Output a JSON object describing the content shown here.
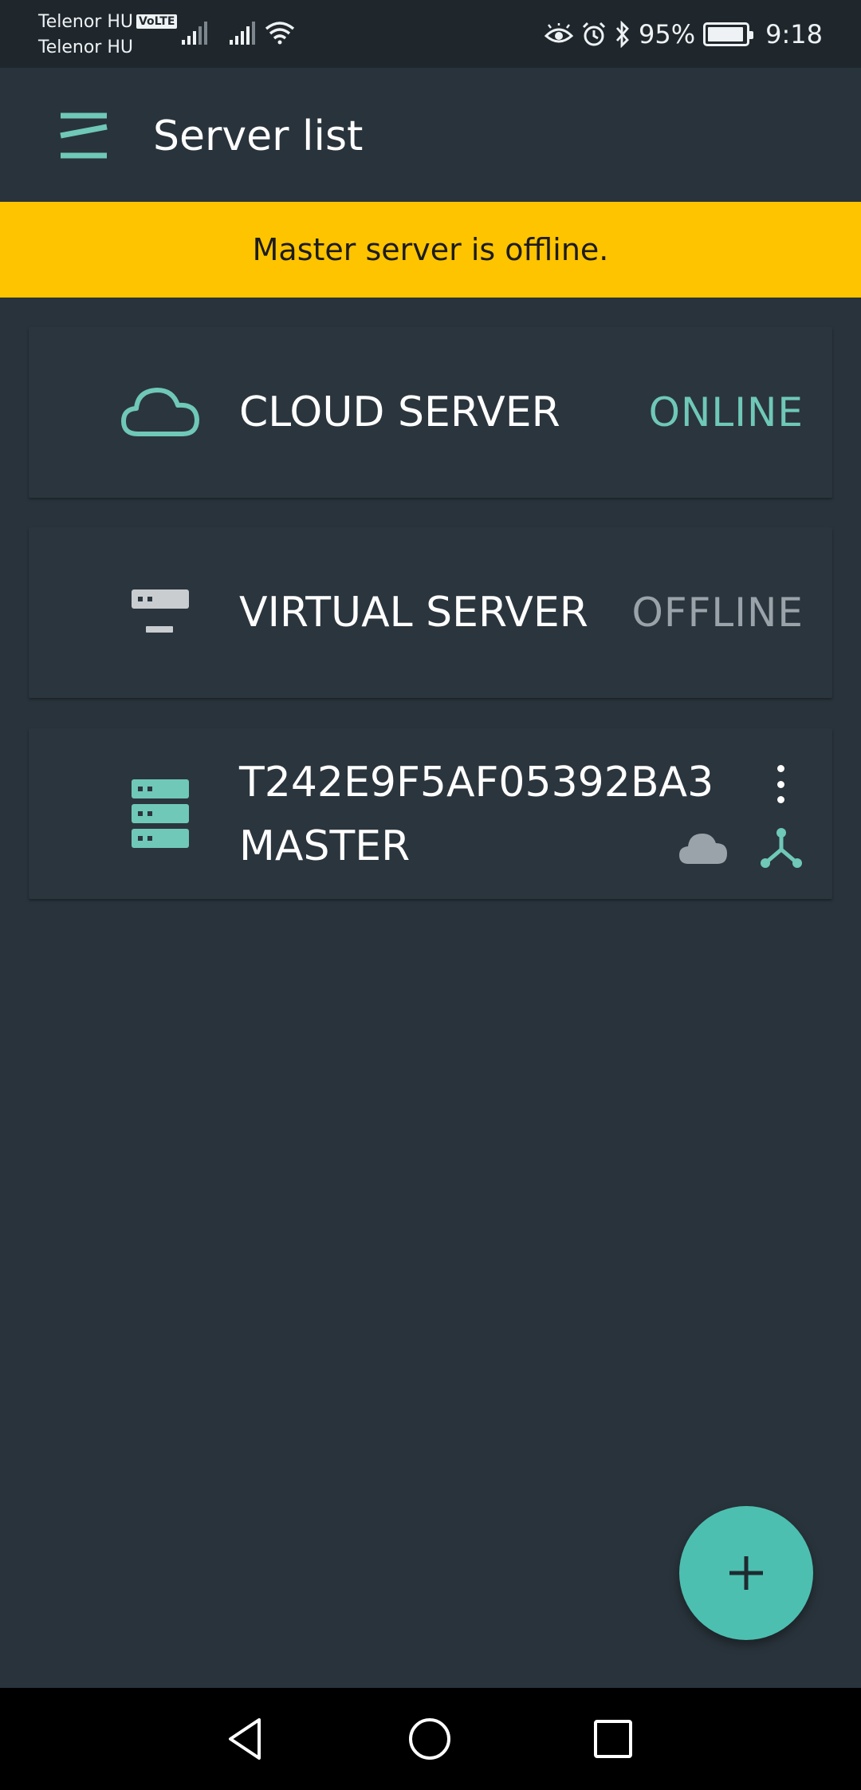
{
  "status_bar": {
    "carrier_1": "Telenor HU",
    "carrier_2": "Telenor HU",
    "volte": "VoLTE",
    "battery_percent": "95%",
    "battery_level": 0.95,
    "time": "9:18",
    "icons": [
      "signal-icon",
      "signal-icon",
      "wifi-icon",
      "eye-icon",
      "alarm-icon",
      "bluetooth-icon",
      "battery-icon"
    ]
  },
  "app_bar": {
    "title": "Server list",
    "menu_icon": "menu-icon"
  },
  "banner": {
    "message": "Master server is offline.",
    "color": "#ffc400"
  },
  "servers": [
    {
      "name": "CLOUD SERVER",
      "status": "ONLINE",
      "icon": "cloud-icon"
    },
    {
      "name": "VIRTUAL SERVER",
      "status": "OFFLINE",
      "icon": "virtual-server-icon"
    },
    {
      "name": "T242E9F5AF05392BA3",
      "role": "MASTER",
      "icon": "server-stack-icon",
      "badges": [
        "cloud-icon",
        "network-icon"
      ]
    }
  ],
  "fab": {
    "icon": "plus-icon"
  },
  "nav_bar": {
    "buttons": [
      "back-icon",
      "home-icon",
      "recents-icon"
    ]
  },
  "colors": {
    "accent": "#6fc8b8",
    "fab": "#4dbfb0",
    "background": "#29333b",
    "card": "#2b353d",
    "offline": "#9aa3a9"
  }
}
